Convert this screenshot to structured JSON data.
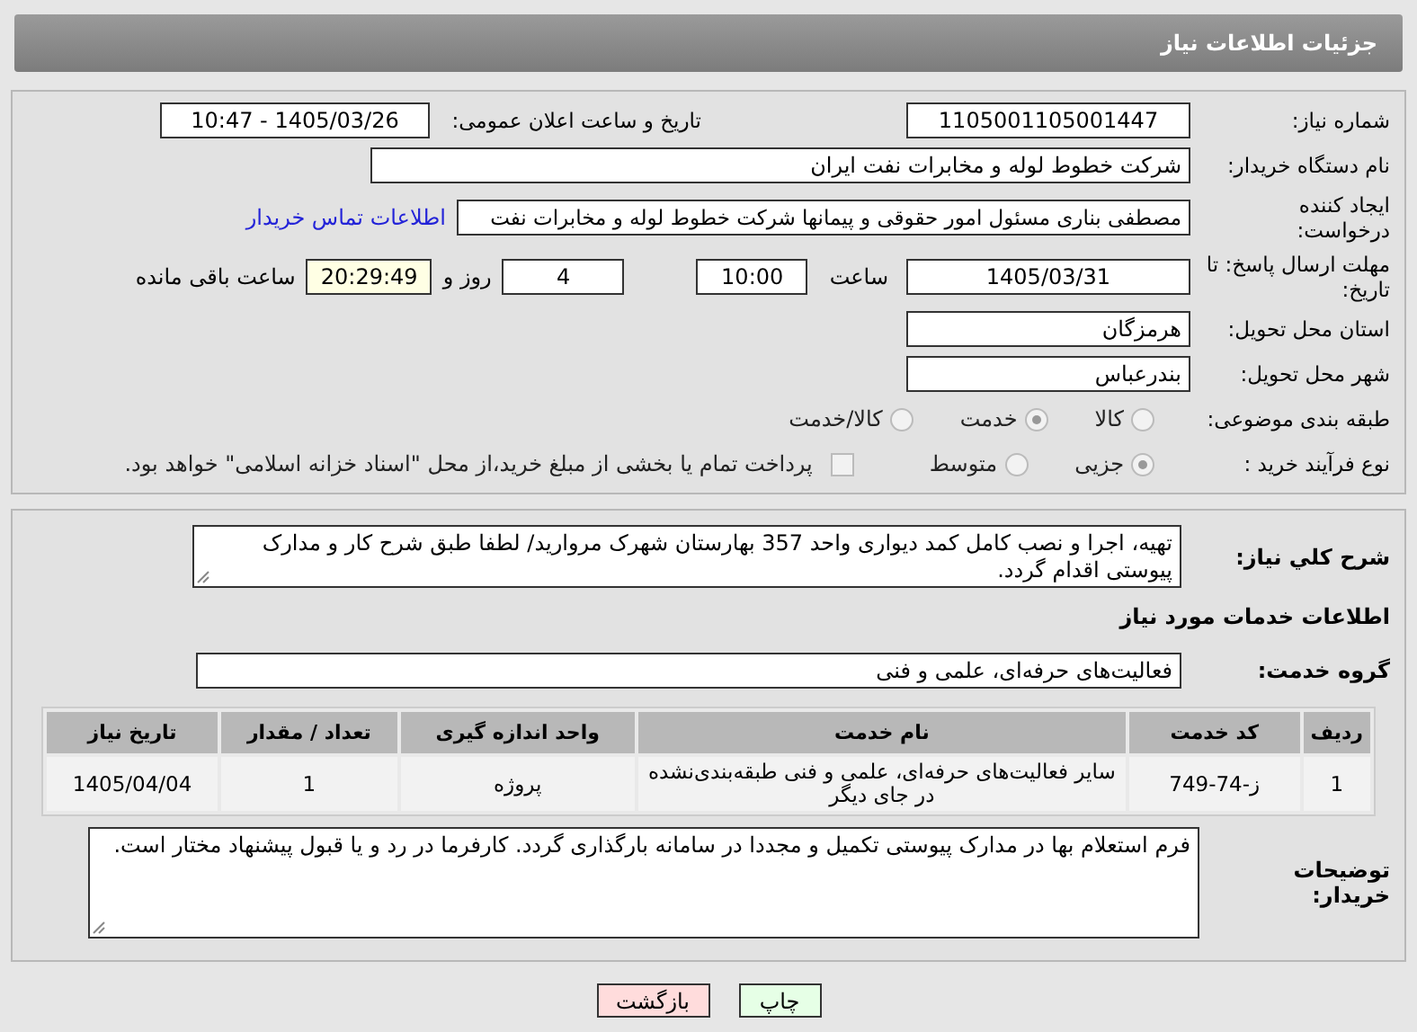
{
  "header": {
    "title": "جزئیات اطلاعات نیاز"
  },
  "need_number": {
    "label": "شماره نیاز:",
    "value": "1105001105001447"
  },
  "announce_date": {
    "label": "تاریخ و ساعت اعلان عمومی:",
    "value": "1405/03/26 - 10:47"
  },
  "buyer": {
    "label": "نام دستگاه خریدار:",
    "value": "شرکت خطوط لوله و مخابرات نفت ایران"
  },
  "requester": {
    "label": "ایجاد کننده درخواست:",
    "value": "مصطفی بناری مسئول امور حقوقی و پیمانها  شرکت خطوط لوله و مخابرات نفت",
    "link": "اطلاعات تماس خریدار"
  },
  "deadline": {
    "label": "مهلت ارسال پاسخ: تا تاریخ:",
    "date": "1405/03/31",
    "time_label": "ساعت",
    "time": "10:00",
    "days": "4",
    "days_label": "روز و",
    "remaining": "20:29:49",
    "remaining_label": "ساعت باقی مانده"
  },
  "province": {
    "label": "استان محل تحویل:",
    "value": "هرمزگان"
  },
  "city": {
    "label": "شهر محل تحویل:",
    "value": "بندرعباس"
  },
  "category": {
    "label": "طبقه بندی موضوعی:",
    "options": [
      {
        "label": "کالا",
        "selected": false
      },
      {
        "label": "خدمت",
        "selected": true
      },
      {
        "label": "کالا/خدمت",
        "selected": false
      }
    ]
  },
  "process": {
    "label": "نوع فرآیند خرید :",
    "options": [
      {
        "label": "جزیی",
        "selected": true
      },
      {
        "label": "متوسط",
        "selected": false
      }
    ],
    "payment": {
      "label": "پرداخت تمام یا بخشی از مبلغ خرید،از محل \"اسناد خزانه اسلامی\" خواهد بود.",
      "checked": false
    }
  },
  "description": {
    "label": "شرح کلي نياز:",
    "value": "تهیه، اجرا و نصب کامل کمد دیواری واحد 357 بهارستان شهرک مروارید/ لطفا طبق شرح کار و مدارک پیوستی اقدام گردد."
  },
  "services_heading": "اطلاعات خدمات مورد نیاز",
  "service_group": {
    "label": "گروه خدمت:",
    "value": "فعالیت‌های حرفه‌ای، علمی و فنی"
  },
  "table": {
    "columns": [
      "ردیف",
      "کد خدمت",
      "نام خدمت",
      "واحد اندازه گیری",
      "تعداد / مقدار",
      "تاریخ نیاز"
    ],
    "rows": [
      [
        "1",
        "ز-74-749",
        "سایر فعالیت‌های حرفه‌ای، علمی و فنی طبقه‌بندی‌نشده در جای دیگر",
        "پروژه",
        "1",
        "1405/04/04"
      ]
    ]
  },
  "buyer_notes": {
    "label": "توضیحات خریدار:",
    "value": "فرم استعلام بها در مدارک پیوستی تکمیل و مجددا در سامانه بارگذاری گردد. کارفرما در رد و یا قبول پیشنهاد مختار است."
  },
  "buttons": [
    {
      "label": "چاپ",
      "kind": "print"
    },
    {
      "label": "بازگشت",
      "kind": "back"
    }
  ]
}
